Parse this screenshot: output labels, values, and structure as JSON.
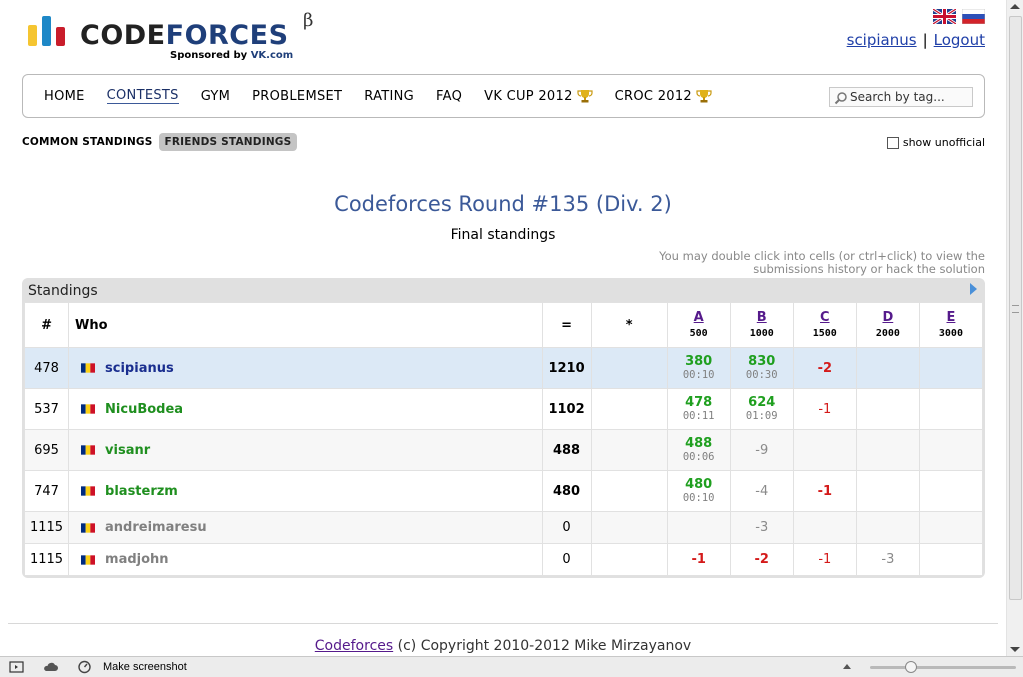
{
  "header": {
    "logo": {
      "code": "CODE",
      "forces": "FORCES",
      "beta": "β",
      "sponsored": "Sponsored by",
      "vk": "VK.com"
    },
    "user": {
      "handle": "scipianus",
      "sep": "|",
      "logout": "Logout"
    }
  },
  "menu": {
    "items": [
      "HOME",
      "CONTESTS",
      "GYM",
      "PROBLEMSET",
      "RATING",
      "FAQ",
      "VK CUP 2012",
      "CROC 2012"
    ],
    "active": "CONTESTS",
    "search_placeholder": "Search by tag..."
  },
  "subtabs": {
    "common": "COMMON STANDINGS",
    "friends": "FRIENDS STANDINGS",
    "active": "FRIENDS STANDINGS"
  },
  "show_unofficial": {
    "label": "show unofficial",
    "checked": false
  },
  "contest": {
    "title": "Codeforces Round #135 (Div. 2)",
    "subtitle": "Final standings",
    "hint": "You may double click into cells (or ctrl+click) to view the submissions history or hack the solution"
  },
  "standings": {
    "title": "Standings",
    "columns": {
      "rank": "#",
      "who": "Who",
      "points": "=",
      "hacks": "*"
    },
    "problems": [
      {
        "letter": "A",
        "points": "500"
      },
      {
        "letter": "B",
        "points": "1000"
      },
      {
        "letter": "C",
        "points": "1500"
      },
      {
        "letter": "D",
        "points": "2000"
      },
      {
        "letter": "E",
        "points": "3000"
      }
    ],
    "rows": [
      {
        "rank": "478",
        "handle": "scipianus",
        "points": "1210",
        "hacks": "",
        "a": "380",
        "a_time": "00:10",
        "b": "830",
        "b_time": "00:30",
        "c": "-2",
        "d": "",
        "e": ""
      },
      {
        "rank": "537",
        "handle": "NicuBodea",
        "points": "1102",
        "hacks": "",
        "a": "478",
        "a_time": "00:11",
        "b": "624",
        "b_time": "01:09",
        "c": "-1",
        "d": "",
        "e": ""
      },
      {
        "rank": "695",
        "handle": "visanr",
        "points": "488",
        "hacks": "",
        "a": "488",
        "a_time": "00:06",
        "b": "-9",
        "c": "",
        "d": "",
        "e": ""
      },
      {
        "rank": "747",
        "handle": "blasterzm",
        "points": "480",
        "hacks": "",
        "a": "480",
        "a_time": "00:10",
        "b": "-4",
        "c": "-1",
        "d": "",
        "e": ""
      },
      {
        "rank": "1115",
        "handle": "andreimaresu",
        "points": "0",
        "hacks": "",
        "a": "",
        "b": "-3",
        "c": "",
        "d": "",
        "e": ""
      },
      {
        "rank": "1115",
        "handle": "madjohn",
        "points": "0",
        "hacks": "",
        "a": "-1",
        "b": "-2",
        "c": "-1",
        "d": "-3",
        "e": ""
      }
    ]
  },
  "footer": {
    "link": "Codeforces",
    "text": " (c) Copyright 2010-2012 Mike Mirzayanov"
  },
  "statusbar": {
    "text": "Make screenshot"
  },
  "colors": {
    "accent": "#3b5998",
    "accepted": "#1f9f1f",
    "rejected": "#d41a1a",
    "highlight_row": "#dce9f6"
  }
}
